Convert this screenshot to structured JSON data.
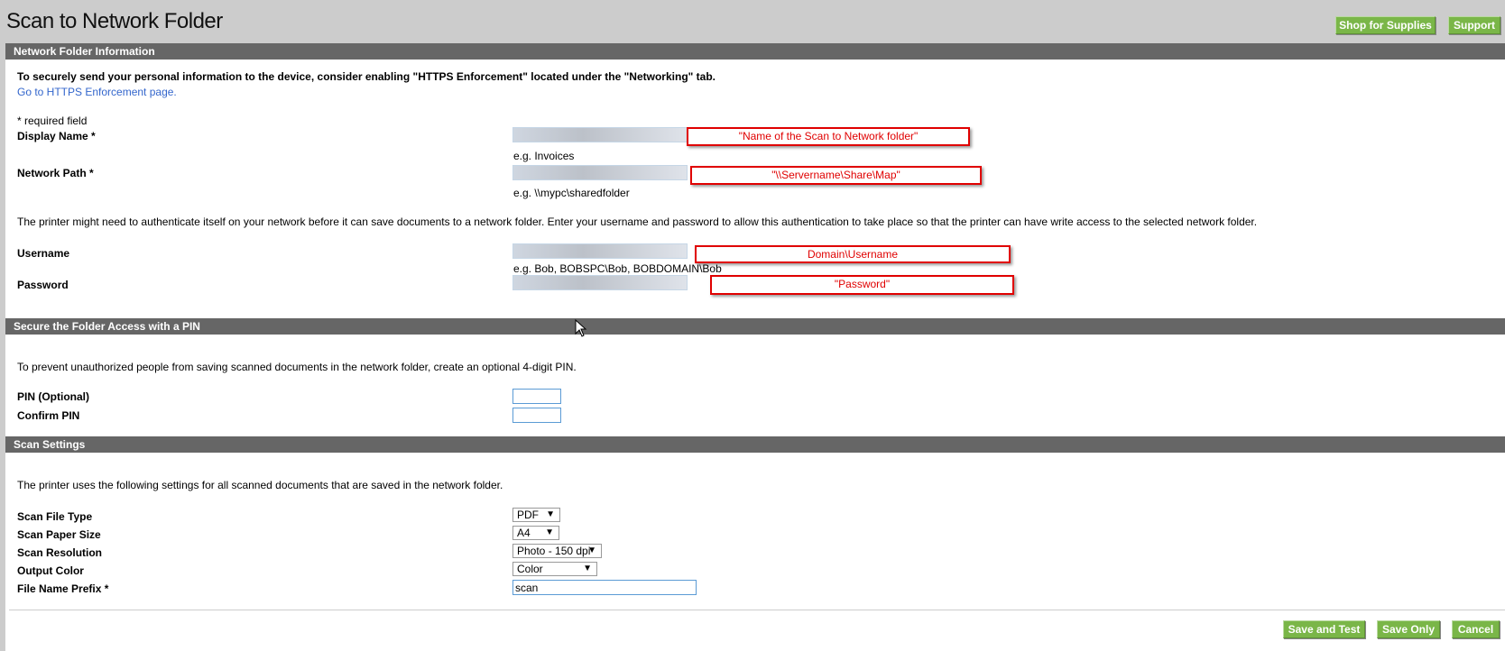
{
  "header": {
    "title": "Scan to Network Folder",
    "shop_label": "Shop for Supplies",
    "support_label": "Support"
  },
  "sections": {
    "network": {
      "title": "Network Folder Information",
      "notice": "To securely send your personal information to the device, consider enabling \"HTTPS Enforcement\" located under the \"Networking\" tab.",
      "link": "Go to HTTPS Enforcement page.",
      "required": "* required field",
      "display_name_label": "Display Name *",
      "display_name_hint": "e.g. Invoices",
      "display_name_annotation": "\"Name of the Scan to Network folder\"",
      "network_path_label": "Network Path *",
      "network_path_hint": "e.g. \\\\mypc\\sharedfolder",
      "network_path_annotation": "\"\\\\Servername\\Share\\Map\"",
      "auth_text": "The printer might need to authenticate itself on your network before it can save documents to a network folder. Enter your username and password to allow this authentication to take place so that the printer can have write access to the selected network folder.",
      "username_label": "Username",
      "username_hint": "e.g. Bob, BOBSPC\\Bob, BOBDOMAIN\\Bob",
      "username_annotation": "Domain\\Username",
      "password_label": "Password",
      "password_annotation": "\"Password\""
    },
    "pin": {
      "title": "Secure the Folder Access with a PIN",
      "text": "To prevent unauthorized people from saving scanned documents in the network folder, create an optional 4-digit PIN.",
      "pin_label": "PIN (Optional)",
      "confirm_label": "Confirm PIN"
    },
    "scan": {
      "title": "Scan Settings",
      "text": "The printer uses the following settings for all scanned documents that are saved in the network folder.",
      "file_type_label": "Scan File Type",
      "file_type": "PDF",
      "paper_size_label": "Scan Paper Size",
      "paper_size": "A4",
      "resolution_label": "Scan Resolution",
      "resolution": "Photo - 150 dpi",
      "color_label": "Output Color",
      "color": "Color",
      "prefix_label": "File Name Prefix *",
      "prefix": "scan"
    }
  },
  "footer": {
    "save_test": "Save and Test",
    "save_only": "Save Only",
    "cancel": "Cancel"
  },
  "colors": {
    "button_green": "#7ab648",
    "section_bar": "#666666",
    "annotation_red": "#e00000",
    "link": "#3366cc"
  }
}
